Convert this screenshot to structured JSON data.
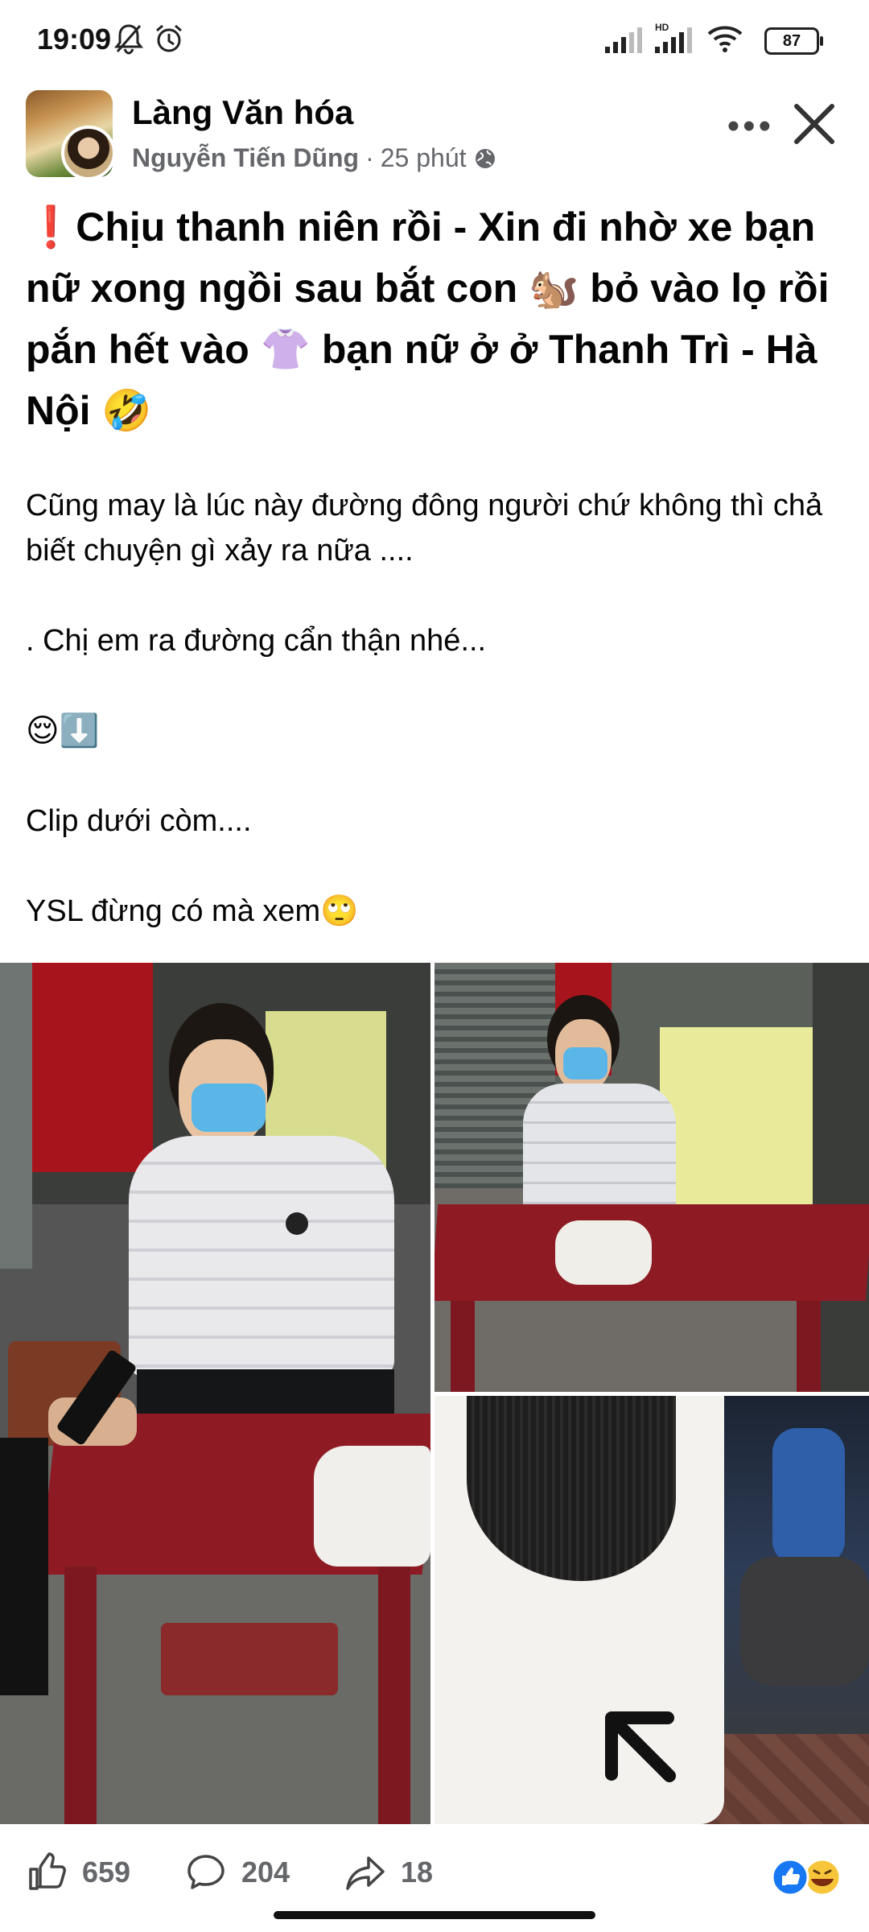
{
  "status_bar": {
    "time": "19:09",
    "network_label": "HD",
    "battery": "87"
  },
  "post": {
    "page_name": "Làng Văn hóa",
    "author": "Nguyễn Tiến Dũng",
    "separator": "·",
    "time_ago": "25 phút",
    "privacy_icon": "globe-icon",
    "title": "❗Chịu thanh niên rồi - Xin đi nhờ xe bạn nữ xong ngồi sau bắt con 🐿️ bỏ vào lọ rồi pắn hết vào 👚 bạn nữ ở ở Thanh Trì - Hà Nội 🤣",
    "body": {
      "line1": "Cũng may là lúc này đường đông người chứ không thì chả biết chuyện gì xảy ra nữa ....",
      "line2": ". Chị em ra đường cẩn thận nhé...",
      "line3": "😌⬇️",
      "line4": "Clip dưới còm....",
      "line5": "YSL đừng có mà xem🙄"
    }
  },
  "actions": {
    "likes": "659",
    "comments": "204",
    "shares": "18"
  },
  "colors": {
    "text": "#050505",
    "secondary": "#65676b",
    "like_blue": "#1877f2",
    "table_red": "#8e1b24"
  }
}
